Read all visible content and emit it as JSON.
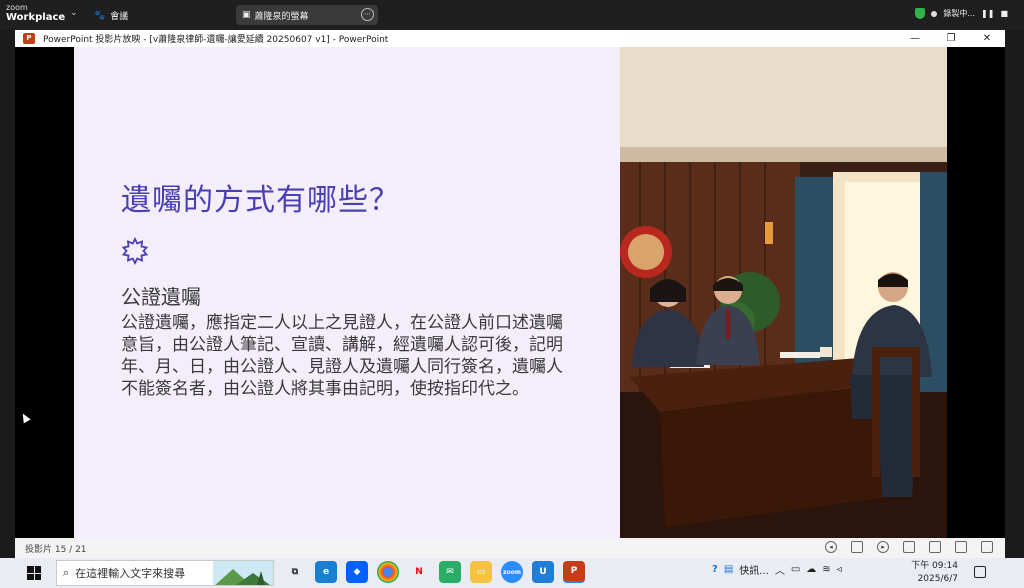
{
  "zoom": {
    "brand_top": "zoom",
    "brand_bottom": "Workplace",
    "meeting_label": "會議",
    "share_label": "蕭隆泉的螢幕",
    "recording_label": "錄製中..."
  },
  "window": {
    "title": "PowerPoint 投影片放映 - [v蕭隆泉律師-遺囑-讓愛延續 20250607 v1] - PowerPoint",
    "app_icon_letter": "P",
    "minimize": "—",
    "restore": "❐",
    "close": "✕"
  },
  "slide": {
    "title": "遺囑的方式有哪些？",
    "subheading": "公證遺囑",
    "body": "公證遺囑，應指定二人以上之見證人，在公證人前口述遺囑意旨，由公證人筆記、宣讀、講解，經遺囑人認可後，記明年、月、日，由公證人、見證人及遺囑人同行簽名，遺囑人不能簽名者，由公證人將其事由記明，使按指印代之。",
    "accent_color": "#4b3fb4"
  },
  "statusbar": {
    "slide_counter": "投影片 15 / 21"
  },
  "taskbar": {
    "search_placeholder": "在這裡輸入文字來搜尋",
    "tray_label": "快訊...",
    "time": "下午 09:14",
    "date": "2025/6/7"
  }
}
